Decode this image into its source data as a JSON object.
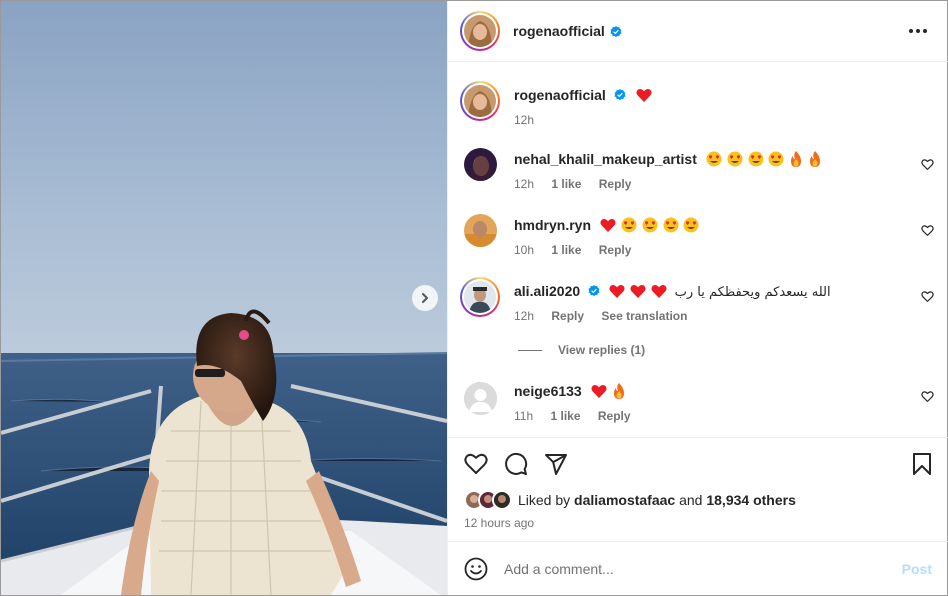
{
  "post": {
    "author": "rogenaofficial",
    "author_verified": true,
    "caption_emoji": "red-heart",
    "caption_time": "12h"
  },
  "header": {
    "username": "rogenaofficial",
    "more_icon": "more-horizontal-icon"
  },
  "comments": [
    {
      "username": "nehal_khalil_makeup_artist",
      "emojis": [
        "heart-eyes",
        "heart-eyes",
        "heart-eyes",
        "heart-eyes",
        "fire",
        "fire"
      ],
      "time": "12h",
      "likes": "1 like",
      "reply": "Reply"
    },
    {
      "username": "hmdryn.ryn",
      "emojis": [
        "red-heart",
        "heart-eyes",
        "heart-eyes",
        "heart-eyes",
        "heart-eyes"
      ],
      "time": "10h",
      "likes": "1 like",
      "reply": "Reply"
    },
    {
      "username": "ali.ali2020",
      "verified": true,
      "emojis": [
        "red-heart",
        "red-heart",
        "red-heart"
      ],
      "text": "الله يسعدكم ويحفظكم يا رب",
      "time": "12h",
      "reply": "Reply",
      "translate": "See translation"
    },
    {
      "username": "neige6133",
      "emojis": [
        "red-heart",
        "fire"
      ],
      "time": "11h",
      "likes": "1 like",
      "reply": "Reply"
    }
  ],
  "view_replies": "View replies (1)",
  "actions": {
    "like_icon": "heart-icon",
    "comment_icon": "comment-icon",
    "share_icon": "send-icon",
    "save_icon": "bookmark-icon"
  },
  "likes": {
    "prefix": "Liked by",
    "user": "daliamostafaac",
    "middle": "and",
    "count": "18,934 others"
  },
  "posted_ago": "12 hours ago",
  "add_comment": {
    "placeholder": "Add a comment...",
    "post_label": "Post"
  },
  "colors": {
    "verified": "#0095f6",
    "heart": "#ed1c24",
    "post_disabled": "#b2dffc",
    "meta": "#737373"
  }
}
